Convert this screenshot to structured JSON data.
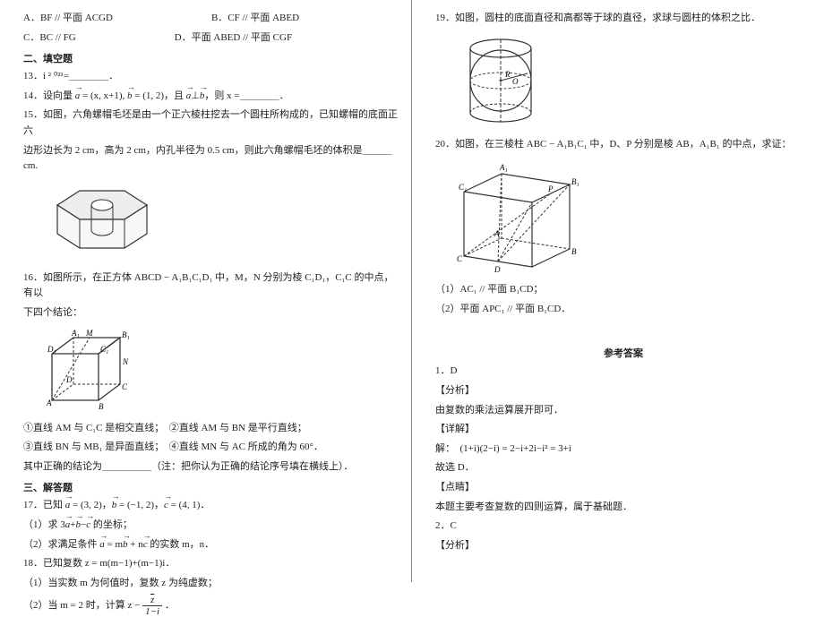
{
  "left": {
    "q12": {
      "A": "A．BF // 平面 ACGD",
      "B": "B．CF // 平面 ABED",
      "C": "C．BC // FG",
      "D": "D．平面 ABED // 平面 CGF"
    },
    "sec_fill": "二、填空题",
    "q13": "13．i ² ⁰²¹=＿＿＿＿．",
    "q14_a": "14．设向量 ",
    "q14_b": " = (x, x+1), ",
    "q14_c": " = (1, 2)，且 ",
    "q14_d": "⊥",
    "q14_e": "，则 x =＿＿＿＿．",
    "q15_a": "15．如图，六角螺帽毛坯是由一个正六棱柱挖去一个圆柱所构成的，已知螺帽的底面正六",
    "q15_b": "边形边长为 2 cm，高为 2 cm，内孔半径为 0.5 cm，则此六角螺帽毛坯的体积是＿＿＿cm.",
    "q16_a": "16．如图所示，在正方体 ABCD − A₁B₁C₁D₁ 中，M，N 分别为棱 C₁D₁，C₁C 的中点，有以",
    "q16_b": "下四个结论：",
    "q16_c1": "①直线 AM 与 C₁C 是相交直线；　②直线 AM 与 BN 是平行直线；",
    "q16_c2": "③直线 BN 与 MB₁ 是异面直线；　④直线 MN 与 AC 所成的角为 60°．",
    "q16_c3": "其中正确的结论为＿＿＿＿＿（注：把你认为正确的结论序号填在横线上）．",
    "sec_solve": "三、解答题",
    "q17_a": "17．已知 ",
    "q17_b": " = (3, 2)，",
    "q17_c": " = (−1, 2)，",
    "q17_d": " = (4, 1)．",
    "q17_1a": "（1）求 3",
    "q17_1b": "+",
    "q17_1c": "−",
    "q17_1d": " 的坐标；",
    "q17_2a": "（2）求满足条件 ",
    "q17_2b": " = m",
    "q17_2c": " + n",
    "q17_2d": " 的实数 m，n．",
    "q18_a": "18．已知复数 z = m(m−1)+(m−1)i．",
    "q18_1": "（1）当实数 m 为何值时，复数 z 为纯虚数；",
    "q18_2a": "（2）当 m = 2 时，计算 z − ",
    "q18_2b": "．"
  },
  "right": {
    "q19": "19．如图，圆柱的底面直径和高都等于球的直径，求球与圆柱的体积之比．",
    "q20_a": "20．如图，在三棱柱 ABC − A₁B₁C₁ 中，D、P 分别是棱 AB，A₁B₁ 的中点，求证：",
    "q20_1": "（1）AC₁ // 平面 B₁CD；",
    "q20_2": "（2）平面 APC₁ // 平面 B₁CD．",
    "ans_title": "参考答案",
    "a1_num": "1．D",
    "a_fx": "【分析】",
    "a1_fx_txt": "由复数的乘法运算展开即可．",
    "a_xj": "【详解】",
    "a1_xj_txt": "解：　(1+i)(2−i) = 2−i+2i−i² = 3+i",
    "a1_gu": "故选 D．",
    "a_dj": "【点睛】",
    "a1_dj_txt": "本题主要考查复数的四则运算，属于基础题．",
    "a2_num": "2．C",
    "a2_fx": "【分析】"
  }
}
